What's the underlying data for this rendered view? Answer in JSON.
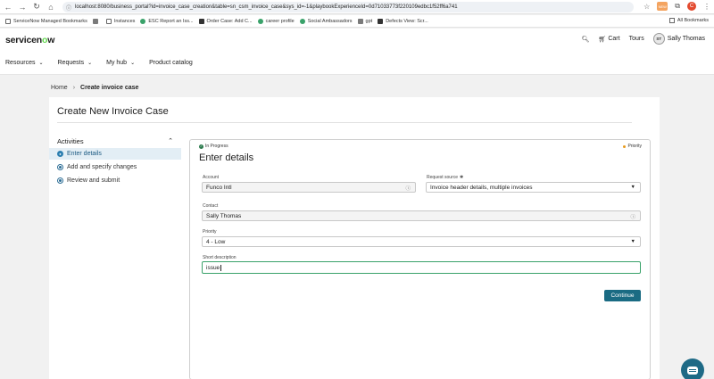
{
  "browser": {
    "url": "localhost:8080/business_portal?id=invoice_case_creation&table=sn_csm_invoice_case&sys_id=-1&playbookExperienceId=0d71033773f220109edbc1f52ff6a741",
    "profile_initial": "C",
    "ext_badge": "NEW"
  },
  "bookmarks": {
    "items": [
      "ServiceNow Managed Bookmarks",
      "Instances",
      "ESC Report an Iss...",
      "Order Case: Add C...",
      "career profile",
      "Social Ambassadors",
      "gpt",
      "Defects View: Scr..."
    ],
    "all_bookmarks": "All Bookmarks"
  },
  "header": {
    "logo_pre": "servicen",
    "logo_o": "o",
    "logo_post": "w",
    "cart": "Cart",
    "tours": "Tours",
    "avatar_initials": "ST",
    "user_name": "Sally Thomas"
  },
  "nav": {
    "items": [
      "Resources",
      "Requests",
      "My hub",
      "Product catalog"
    ]
  },
  "breadcrumb": {
    "home": "Home",
    "current": "Create invoice case"
  },
  "page": {
    "title": "Create New Invoice Case"
  },
  "activities": {
    "title": "Activities",
    "steps": [
      "Enter details",
      "Add and specify changes",
      "Review and submit"
    ]
  },
  "form": {
    "status": "In Progress",
    "priority_flag": "Priority",
    "title": "Enter details",
    "account_label": "Account",
    "account_value": "Funco Intl",
    "request_source_label": "Request source",
    "request_source_value": "Invoice header details, multiple invoices",
    "contact_label": "Contact",
    "contact_value": "Sally Thomas",
    "priority_label": "Priority",
    "priority_value": "4 - Low",
    "short_desc_label": "Short description",
    "short_desc_value": "issue",
    "continue_label": "Continue"
  }
}
